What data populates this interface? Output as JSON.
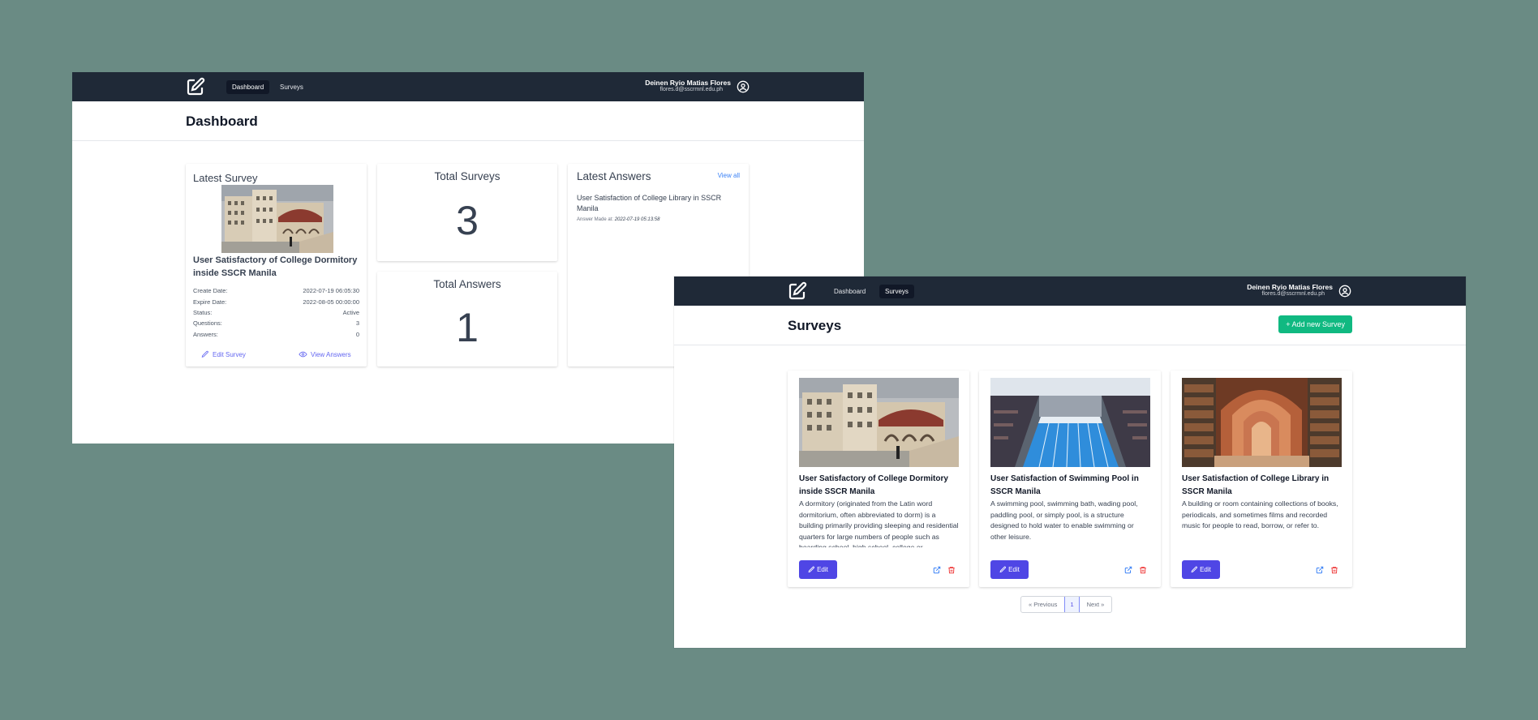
{
  "nav": {
    "dashboard": "Dashboard",
    "surveys": "Surveys",
    "user_name": "Deinen Ryio Matias Flores",
    "user_email": "flores.d@sscrmnl.edu.ph"
  },
  "dashboard": {
    "title": "Dashboard",
    "latest_survey": {
      "heading": "Latest Survey",
      "name": "User Satisfactory of College Dormitory inside SSCR Manila",
      "create_label": "Create Date:",
      "create_value": "2022-07-19 06:05:30",
      "expire_label": "Expire Date:",
      "expire_value": "2022-08-05 00:00:00",
      "status_label": "Status:",
      "status_value": "Active",
      "questions_label": "Questions:",
      "questions_value": "3",
      "answers_label": "Answers:",
      "answers_value": "0",
      "edit_label": "Edit Survey",
      "view_label": "View Answers"
    },
    "total_surveys": {
      "label": "Total Surveys",
      "value": "3"
    },
    "total_answers": {
      "label": "Total Answers",
      "value": "1"
    },
    "latest_answers": {
      "heading": "Latest Answers",
      "view_all": "View all",
      "item": "User Satisfaction of College Library in SSCR Manila",
      "meta_label": "Answer Made at:",
      "meta_value": "2022-07-19 05:13:58"
    }
  },
  "surveys": {
    "title": "Surveys",
    "add_button": "+ Add new Survey",
    "cards": [
      {
        "title": "User Satisfactory of College Dormitory inside SSCR Manila",
        "desc": "A dormitory (originated from the Latin word dormitorium, often abbreviated to dorm) is a building primarily providing sleeping and residential quarters for large numbers of people such as boarding school, high school, college or",
        "edit": "Edit"
      },
      {
        "title": "User Satisfaction of Swimming Pool in SSCR Manila",
        "desc": "A swimming pool, swimming bath, wading pool, paddling pool, or simply pool, is a structure designed to hold water to enable swimming or other leisure.",
        "edit": "Edit"
      },
      {
        "title": "User Satisfaction of College Library in SSCR Manila",
        "desc": "A building or room containing collections of books, periodicals, and sometimes films and recorded music for people to read, borrow, or refer to.",
        "edit": "Edit"
      }
    ],
    "pager": {
      "prev": "« Previous",
      "page": "1",
      "next": "Next »"
    }
  }
}
